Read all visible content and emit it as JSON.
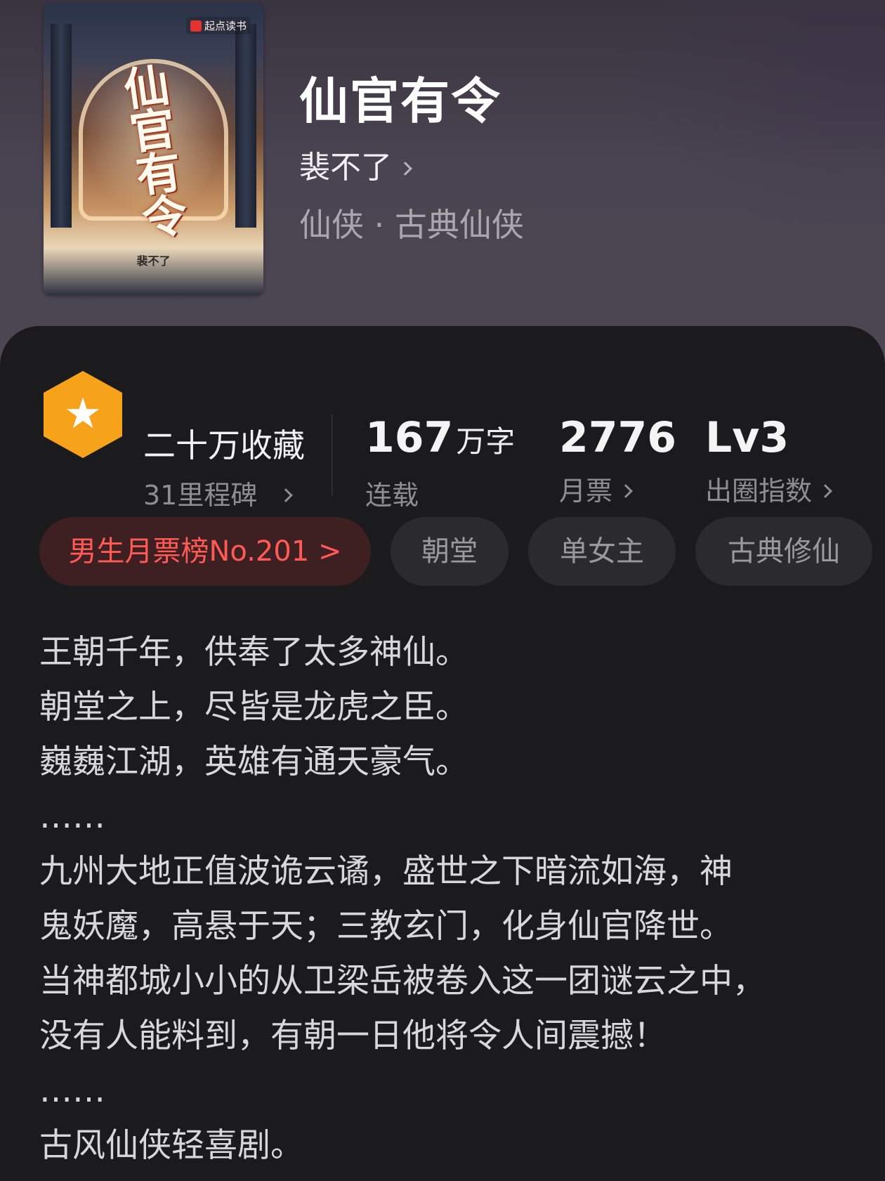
{
  "book": {
    "title": "仙官有令",
    "author": "裴不了",
    "genre": "仙侠 · 古典仙侠",
    "cover": {
      "brand": "起点读书",
      "title": "仙官有令",
      "author": "裴不了"
    }
  },
  "stats": {
    "collection": {
      "main": "二十万收藏",
      "sub": "31里程碑"
    },
    "words": {
      "value": "167",
      "unit": "万字",
      "label": "连载"
    },
    "monthly_votes": {
      "value": "2776",
      "label": "月票"
    },
    "breakout_index": {
      "value": "Lv3",
      "label": "出圈指数"
    }
  },
  "tags": [
    "男生月票榜No.201 >",
    "朝堂",
    "单女主",
    "古典修仙"
  ],
  "synopsis": [
    "王朝千年，供奉了太多神仙。",
    "朝堂之上，尽皆是龙虎之臣。",
    "巍巍江湖，英雄有通天豪气。",
    "……",
    "九州大地正值波诡云谲，盛世之下暗流如海，神",
    "鬼妖魔，高悬于天；三教玄门，化身仙官降世。",
    "当神都城小小的从卫梁岳被卷入这一团谜云之中，",
    "没有人能料到，有朝一日他将令人间震撼！",
    "……",
    "古风仙侠轻喜剧。"
  ],
  "colors": {
    "background": "#1b1b1d",
    "header": "#4a4452",
    "rank_tag_bg": "#3e1f22",
    "rank_tag_text": "#ff5a55",
    "badge": "#f6a21a"
  }
}
